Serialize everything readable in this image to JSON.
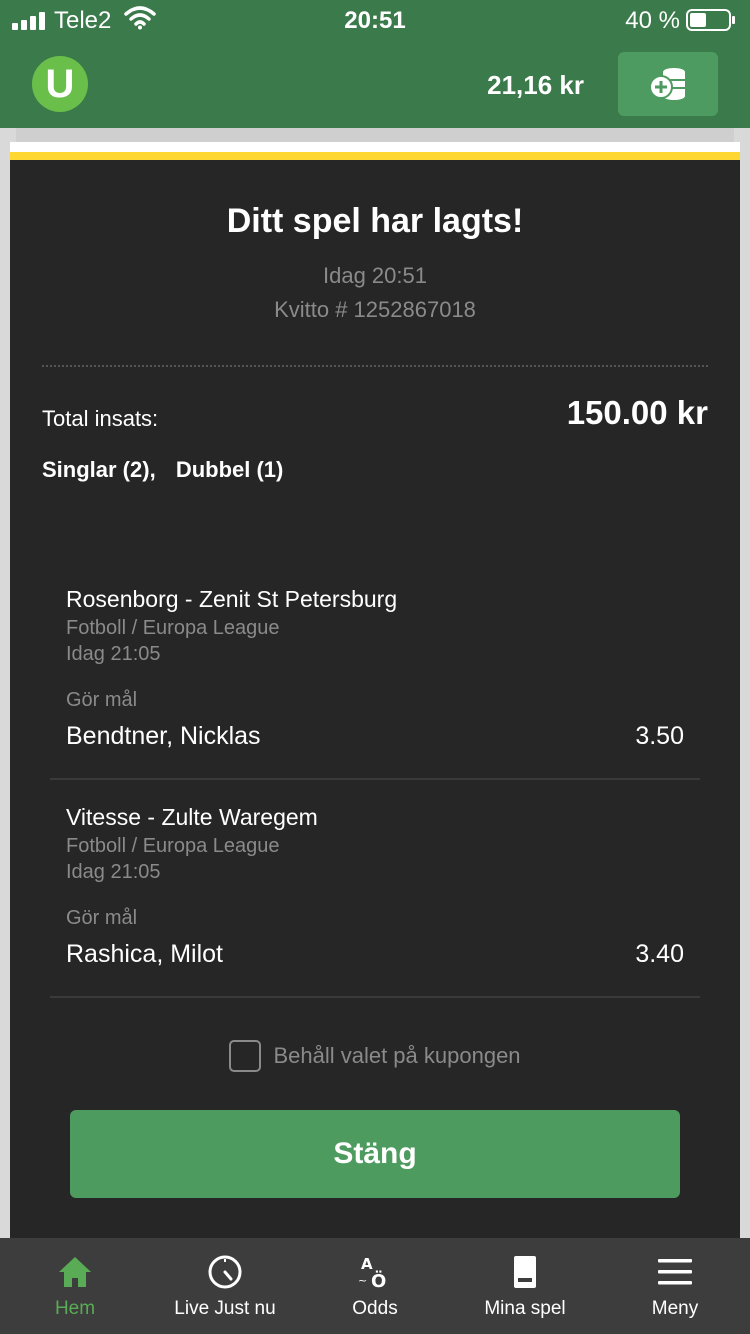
{
  "status_bar": {
    "carrier": "Tele2",
    "time": "20:51",
    "battery_percent": "40 %"
  },
  "header": {
    "logo_letter": "U",
    "balance": "21,16 kr"
  },
  "receipt": {
    "title": "Ditt spel har lagts!",
    "date": "Idag 20:51",
    "ticket": "Kvitto # 1252867018",
    "total_label": "Total insats:",
    "total_value": "150.00 kr",
    "bet_types": [
      "Singlar (2),",
      "Dubbel (1)"
    ]
  },
  "selections": [
    {
      "event": "Rosenborg - Zenit St Petersburg",
      "sport": "Fotboll / Europa League",
      "time": "Idag 21:05",
      "market": "Gör mål",
      "player": "Bendtner, Nicklas",
      "odds": "3.50"
    },
    {
      "event": "Vitesse - Zulte Waregem",
      "sport": "Fotboll / Europa League",
      "time": "Idag 21:05",
      "market": "Gör mål",
      "player": "Rashica, Milot",
      "odds": "3.40"
    }
  ],
  "keep_selection_label": "Behåll valet på kupongen",
  "close_button": "Stäng",
  "nav": [
    {
      "label": "Hem",
      "icon": "home-icon",
      "active": true
    },
    {
      "label": "Live Just nu",
      "icon": "clock-icon",
      "active": false
    },
    {
      "label": "Odds",
      "icon": "odds-icon",
      "active": false
    },
    {
      "label": "Mina spel",
      "icon": "ticket-icon",
      "active": false
    },
    {
      "label": "Meny",
      "icon": "menu-icon",
      "active": false
    }
  ],
  "colors": {
    "header_green": "#3b7a4b",
    "button_green": "#4e9b5f",
    "accent_yellow": "#ffd733",
    "active_nav": "#5aab55"
  }
}
